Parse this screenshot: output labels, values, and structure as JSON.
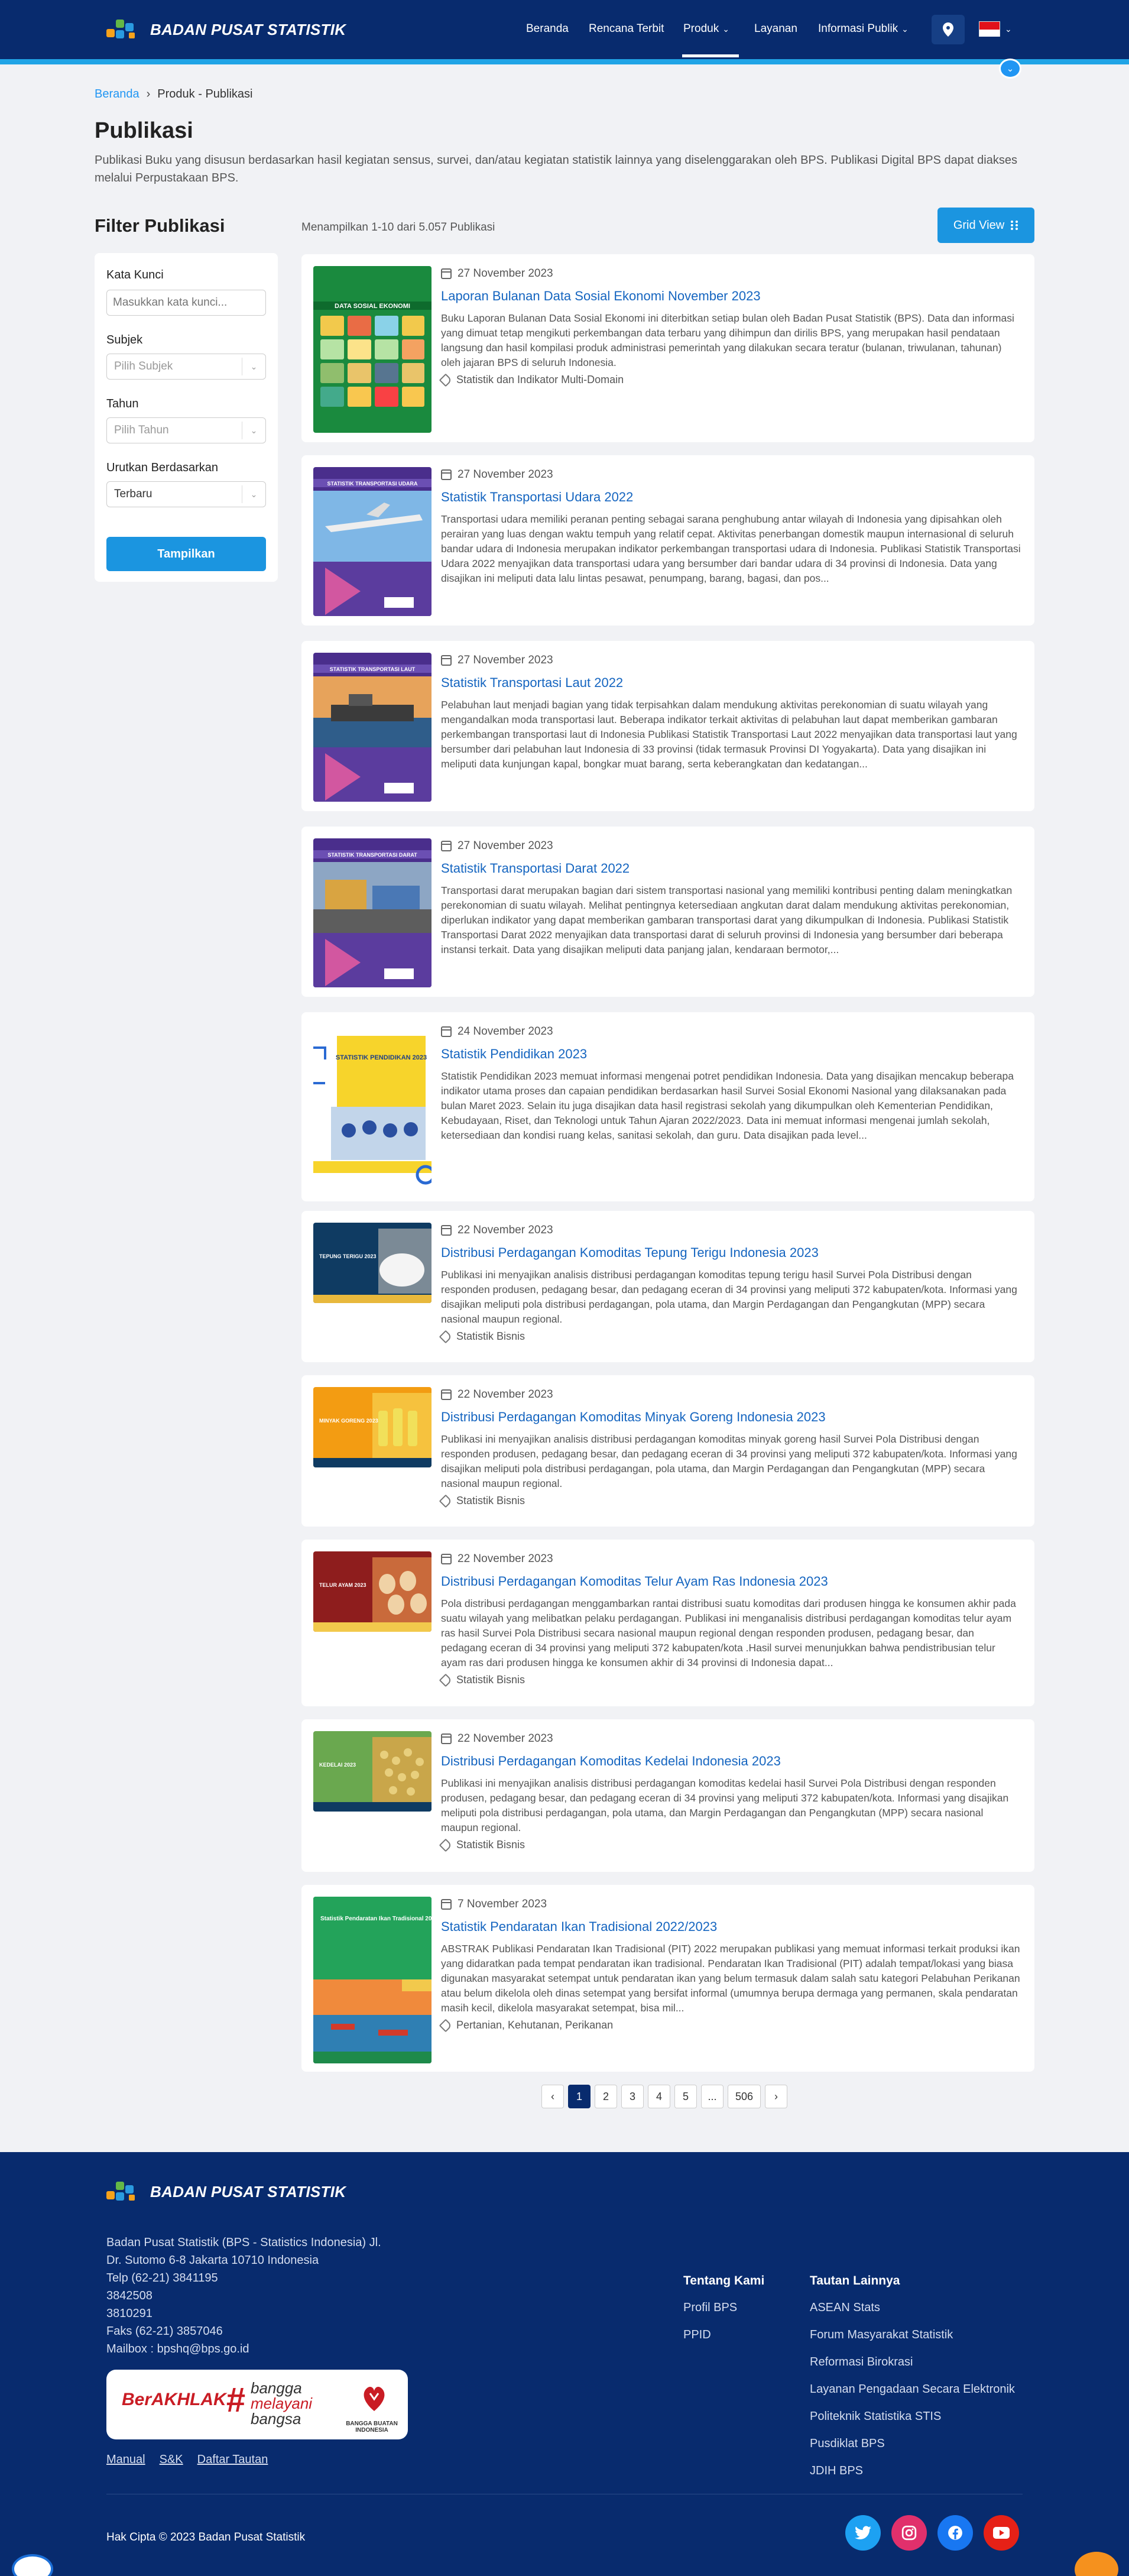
{
  "brand": {
    "name": "BADAN PUSAT STATISTIK"
  },
  "nav": {
    "items": [
      {
        "label": "Beranda"
      },
      {
        "label": "Rencana Terbit"
      },
      {
        "label": "Produk"
      },
      {
        "label": "Layanan"
      },
      {
        "label": "Informasi Publik"
      }
    ],
    "active": "Produk"
  },
  "breadcrumb": {
    "home": "Beranda",
    "current": "Produk - Publikasi"
  },
  "page": {
    "title": "Publikasi",
    "description": "Publikasi Buku yang disusun berdasarkan hasil kegiatan sensus, survei, dan/atau kegiatan statistik lainnya yang diselenggarakan oleh BPS. Publikasi Digital BPS dapat diakses melalui Perpustakaan BPS."
  },
  "filter": {
    "title": "Filter Publikasi",
    "keyword_label": "Kata Kunci",
    "keyword_placeholder": "Masukkan kata kunci...",
    "subject_label": "Subjek",
    "subject_value": "Pilih Subjek",
    "year_label": "Tahun",
    "year_value": "Pilih Tahun",
    "sort_label": "Urutkan Berdasarkan",
    "sort_value": "Terbaru",
    "submit_label": "Tampilkan"
  },
  "results": {
    "count_text": "Menampilkan 1-10 dari 5.057 Publikasi",
    "view_button": "Grid View"
  },
  "publications": [
    {
      "date": "27 November 2023",
      "title": "Laporan Bulanan Data Sosial Ekonomi November 2023",
      "abstract": "Buku Laporan Bulanan Data Sosial Ekonomi ini diterbitkan setiap bulan oleh Badan Pusat Statistik (BPS). Data dan informasi yang dimuat tetap mengikuti perkembangan data terbaru yang dihimpun dan dirilis BPS, yang merupakan hasil pendataan langsung dan hasil kompilasi produk administrasi pemerintah yang dilakukan secara teratur (bulanan, triwulanan, tahunan) oleh jajaran BPS di seluruh Indonesia.",
      "tag": "Statistik dan Indikator Multi-Domain",
      "cover": "DATA SOSIAL EKONOMI"
    },
    {
      "date": "27 November 2023",
      "title": "Statistik Transportasi Udara 2022",
      "abstract": "Transportasi udara memiliki peranan penting sebagai sarana penghubung antar wilayah di Indonesia yang dipisahkan oleh perairan yang luas dengan waktu tempuh yang relatif cepat. Aktivitas penerbangan domestik maupun internasional di seluruh bandar udara di Indonesia merupakan indikator perkembangan transportasi udara di Indonesia. Publikasi Statistik Transportasi Udara 2022 menyajikan data transportasi udara yang bersumber dari bandar udara di 34 provinsi di Indonesia. Data yang disajikan ini meliputi data lalu lintas pesawat, penumpang, barang, bagasi, dan pos...",
      "tag": "",
      "cover": "STATISTIK TRANSPORTASI UDARA"
    },
    {
      "date": "27 November 2023",
      "title": "Statistik Transportasi Laut 2022",
      "abstract": "Pelabuhan laut menjadi bagian yang tidak terpisahkan dalam mendukung aktivitas perekonomian di suatu wilayah yang mengandalkan moda transportasi laut. Beberapa indikator terkait aktivitas di pelabuhan laut dapat memberikan gambaran perkembangan transportasi laut di Indonesia Publikasi Statistik Transportasi Laut 2022 menyajikan data transportasi laut yang bersumber dari pelabuhan laut Indonesia di 33 provinsi (tidak termasuk Provinsi DI Yogyakarta). Data yang disajikan ini meliputi data kunjungan kapal, bongkar muat barang, serta keberangkatan dan kedatangan...",
      "tag": "",
      "cover": "STATISTIK TRANSPORTASI LAUT"
    },
    {
      "date": "27 November 2023",
      "title": "Statistik Transportasi Darat 2022",
      "abstract": "Transportasi darat merupakan bagian dari sistem transportasi nasional yang memiliki kontribusi penting dalam meningkatkan perekonomian di suatu wilayah. Melihat pentingnya ketersediaan angkutan darat dalam mendukung aktivitas perekonomian, diperlukan indikator yang dapat memberikan gambaran transportasi darat yang dikumpulkan di Indonesia. Publikasi Statistik Transportasi Darat 2022 menyajikan data transportasi darat di seluruh provinsi di Indonesia yang bersumber dari beberapa instansi terkait. Data yang disajikan meliputi data panjang jalan, kendaraan bermotor,...",
      "tag": "",
      "cover": "STATISTIK TRANSPORTASI DARAT"
    },
    {
      "date": "24 November 2023",
      "title": "Statistik Pendidikan 2023",
      "abstract": "Statistik Pendidikan 2023 memuat informasi mengenai potret pendidikan Indonesia. Data yang disajikan mencakup beberapa indikator utama proses dan capaian pendidikan berdasarkan hasil Survei Sosial Ekonomi Nasional yang dilaksanakan pada bulan Maret 2023. Selain itu juga disajikan data hasil registrasi sekolah yang dikumpulkan oleh Kementerian Pendidikan, Kebudayaan, Riset, dan Teknologi untuk Tahun Ajaran 2022/2023. Data ini memuat informasi mengenai jumlah sekolah, ketersediaan dan kondisi ruang kelas, sanitasi sekolah, dan guru. Data disajikan pada level...",
      "tag": "",
      "cover": "STATISTIK PENDIDIKAN 2023"
    },
    {
      "date": "22 November 2023",
      "title": "Distribusi Perdagangan Komoditas Tepung Terigu Indonesia 2023",
      "abstract": "Publikasi ini menyajikan analisis distribusi perdagangan komoditas tepung terigu hasil Survei Pola Distribusi dengan responden produsen, pedagang besar, dan pedagang eceran di 34 provinsi yang meliputi 372 kabupaten/kota. Informasi yang disajikan meliputi pola distribusi perdagangan, pola utama, dan Margin Perdagangan dan Pengangkutan (MPP) secara nasional maupun regional.",
      "tag": "Statistik Bisnis",
      "cover": "TEPUNG TERIGU 2023"
    },
    {
      "date": "22 November 2023",
      "title": "Distribusi Perdagangan Komoditas Minyak Goreng Indonesia 2023",
      "abstract": "Publikasi ini menyajikan analisis distribusi perdagangan komoditas minyak goreng hasil Survei Pola Distribusi dengan responden produsen, pedagang besar, dan pedagang eceran di 34 provinsi yang meliputi 372 kabupaten/kota. Informasi yang disajikan meliputi pola distribusi perdagangan, pola utama, dan Margin Perdagangan dan Pengangkutan (MPP) secara nasional maupun regional.",
      "tag": "Statistik Bisnis",
      "cover": "MINYAK GORENG 2023"
    },
    {
      "date": "22 November 2023",
      "title": "Distribusi Perdagangan Komoditas Telur Ayam Ras Indonesia 2023",
      "abstract": "Pola distribusi perdagangan menggambarkan rantai distribusi suatu komoditas dari produsen hingga ke konsumen akhir pada suatu wilayah yang melibatkan pelaku perdagangan. Publikasi ini menganalisis distribusi perdagangan komoditas telur ayam ras hasil Survei Pola Distribusi secara nasional maupun regional dengan responden produsen, pedagang besar, dan pedagang eceran di 34 provinsi yang meliputi 372 kabupaten/kota .Hasil survei menunjukkan bahwa pendistribusian telur ayam ras dari produsen hingga ke konsumen akhir di 34 provinsi di Indonesia dapat...",
      "tag": "Statistik Bisnis",
      "cover": "TELUR AYAM 2023"
    },
    {
      "date": "22 November 2023",
      "title": "Distribusi Perdagangan Komoditas Kedelai Indonesia 2023",
      "abstract": "Publikasi ini menyajikan analisis distribusi perdagangan komoditas kedelai hasil Survei Pola Distribusi dengan responden produsen, pedagang besar, dan pedagang eceran di 34 provinsi yang meliputi 372 kabupaten/kota. Informasi yang disajikan meliputi pola distribusi perdagangan, pola utama, dan Margin Perdagangan dan Pengangkutan (MPP) secara nasional maupun regional.",
      "tag": "Statistik Bisnis",
      "cover": "KEDELAI 2023"
    },
    {
      "date": "7 November 2023",
      "title": "Statistik Pendaratan Ikan Tradisional 2022/2023",
      "abstract": "ABSTRAK Publikasi Pendaratan Ikan Tradisional (PIT) 2022 merupakan publikasi yang memuat informasi terkait produksi ikan yang didaratkan pada tempat pendaratan ikan tradisional. Pendaratan Ikan Tradisional (PIT) adalah tempat/lokasi yang biasa digunakan masyarakat setempat untuk pendaratan ikan yang belum termasuk dalam salah satu kategori Pelabuhan Perikanan atau belum dikelola oleh dinas setempat yang bersifat informal (umumnya berupa dermaga yang permanen, skala pendaratan masih kecil, dikelola masyarakat setempat, bisa mil...",
      "tag": "Pertanian, Kehutanan, Perikanan",
      "cover": "Statistik Pendaratan Ikan Tradisional 2022/2023"
    }
  ],
  "pagination": {
    "pages": [
      "1",
      "2",
      "3",
      "4",
      "5",
      "...",
      "506"
    ],
    "active": "1"
  },
  "footer": {
    "address_lines": [
      "Badan Pusat Statistik (BPS - Statistics Indonesia) Jl.",
      "Dr. Sutomo 6-8 Jakarta 10710 Indonesia",
      "Telp (62-21) 3841195",
      "3842508",
      "3810291",
      "Faks (62-21) 3857046",
      "Mailbox : bpshq@bps.go.id"
    ],
    "berakhlak": {
      "main": "BerAKHLAK",
      "hash": "#",
      "line1": "bangga",
      "line2": "melayani",
      "line3": "bangsa",
      "bbi": "BANGGA BUATAN INDONESIA"
    },
    "links": [
      "Manual",
      "S&K",
      "Daftar Tautan"
    ],
    "about_title": "Tentang Kami",
    "about_items": [
      "Profil BPS",
      "PPID"
    ],
    "related_title": "Tautan Lainnya",
    "related_items": [
      "ASEAN Stats",
      "Forum Masyarakat Statistik",
      "Reformasi Birokrasi",
      "Layanan Pengadaan Secara Elektronik",
      "Politeknik Statistika STIS",
      "Pusdiklat BPS",
      "JDIH BPS"
    ],
    "copyright": "Hak Cipta © 2023 Badan Pusat Statistik",
    "social": [
      "twitter-icon",
      "instagram-icon",
      "facebook-icon",
      "youtube-icon"
    ]
  },
  "colors": {
    "primary": "#082b6e",
    "accent": "#1b95e0",
    "link": "#1565c0"
  }
}
